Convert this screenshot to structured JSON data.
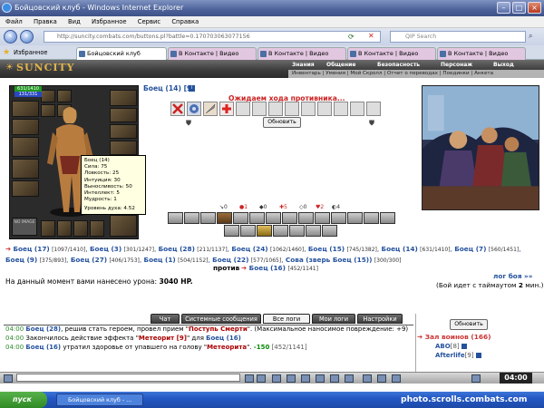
{
  "browser": {
    "window_title": "Бойцовский клуб - Windows Internet Explorer",
    "menu": [
      "Файл",
      "Правка",
      "Вид",
      "Избранное",
      "Сервис",
      "Справка"
    ],
    "url": "http://suncity.combats.com/buttons.pl?battle=0.170703063077156",
    "search_placeholder": "QIP Search",
    "favorites_label": "Избранное",
    "tabs": [
      {
        "label": "Бойцовский клуб",
        "active": true
      },
      {
        "label": "В Контакте | Видео",
        "active": false
      },
      {
        "label": "В Контакте | Видео",
        "active": false
      },
      {
        "label": "В Контакте | Видео",
        "active": false
      },
      {
        "label": "В Контакте | Видео",
        "active": false
      }
    ]
  },
  "site": {
    "logo": "SUNCITY",
    "nav": [
      "Знания",
      "Общение",
      "Безопасность",
      "Персонаж",
      "Выход"
    ],
    "subnav": "Инвентарь | Умения | Мой Скролл | Отчет о переводах | Поединки | Анкета"
  },
  "player": {
    "hp": "631/1410",
    "mp": "131/331",
    "noimage": "NO IMAGE",
    "tooltip": {
      "name": "Боец (14)",
      "stats": [
        "Сила: 75",
        "Ловкость: 25",
        "Интуиция: 30",
        "Выносливость: 50",
        "Интеллект: 5",
        "Мудрость: 1"
      ],
      "spirit": "Уровень духа: 4.52"
    }
  },
  "battle": {
    "fighter_label": "Боец (14) [9]",
    "waiting": "Ожидаем хода противника...",
    "refresh_label": "Обновить",
    "counters": [
      "0",
      "1",
      "0",
      "5",
      "0",
      "2",
      "4"
    ],
    "teams": [
      {
        "name": "Боец (17)",
        "hp": "[1097/1410]"
      },
      {
        "name": "Боец (3)",
        "hp": "[301/1247]"
      },
      {
        "name": "Боец (28)",
        "hp": "[211/1137]"
      },
      {
        "name": "Боец (24)",
        "hp": "[1062/1460]"
      },
      {
        "name": "Боец (15)",
        "hp": "[745/1382]"
      },
      {
        "name": "Боец (14)",
        "hp": "[631/1410]"
      },
      {
        "name": "Боец (7)",
        "hp": "[560/1451]"
      },
      {
        "name": "Боец (9)",
        "hp": "[375/893]"
      },
      {
        "name": "Боец (27)",
        "hp": "[406/1753]"
      },
      {
        "name": "Боец (1)",
        "hp": "[504/1152]"
      },
      {
        "name": "Боец (22)",
        "hp": "[577/1065]"
      },
      {
        "name": "Сова (зверь Боец (15))",
        "hp": "[300/300]"
      }
    ],
    "versus_label": "против",
    "opponent": {
      "name": "Боец (16)",
      "hp": "[452/1141]"
    },
    "damage_label": "На данный момент вами нанесено урона:",
    "damage_value": "3040 HP.",
    "log_link": "лог боя »»",
    "timeout_prefix": "(Бой идет с таймаутом",
    "timeout_value": "2",
    "timeout_suffix": "мин.)"
  },
  "log_tabs": [
    "Чат",
    "Системные сообщения",
    "Все логи",
    "Мои логи",
    "Настройки"
  ],
  "log": [
    {
      "time": "04:00",
      "name": "Боец (28)",
      "text1": ", решив стать героем, провел прием \"",
      "quote": "Поступь Смерти",
      "text2": "\". (Максимальное наносимое повреждение: +9)"
    },
    {
      "time": "04:00",
      "text1": "Закончилось действие эффекта \"",
      "quote": "Метеорит [9]",
      "text2": "\" для ",
      "name": "Боец (16)"
    },
    {
      "time": "04:00",
      "name": "Боец (16)",
      "text1": " утратил здоровье от упавшего на голову \"",
      "quote": "Метеорита",
      "text2": "\". ",
      "damage": "-150",
      "hp": "[452/1141]"
    }
  ],
  "warriors": {
    "refresh_label": "Обновить",
    "title": "Зал воинов (166)",
    "list": [
      {
        "name": "ABO",
        "level": "[8]"
      },
      {
        "name": "Afterlife",
        "level": "[9]"
      }
    ]
  },
  "clock": "04:00",
  "taskbar": {
    "start": "пуск",
    "item": "Бойцовский клуб - ..."
  },
  "watermark": "photo.scrolls.combats.com",
  "colors": {
    "link_blue": "#24519d",
    "alert_red": "#cc2222",
    "hp_green": "#1f9a1f",
    "mp_blue": "#2a48c0"
  }
}
